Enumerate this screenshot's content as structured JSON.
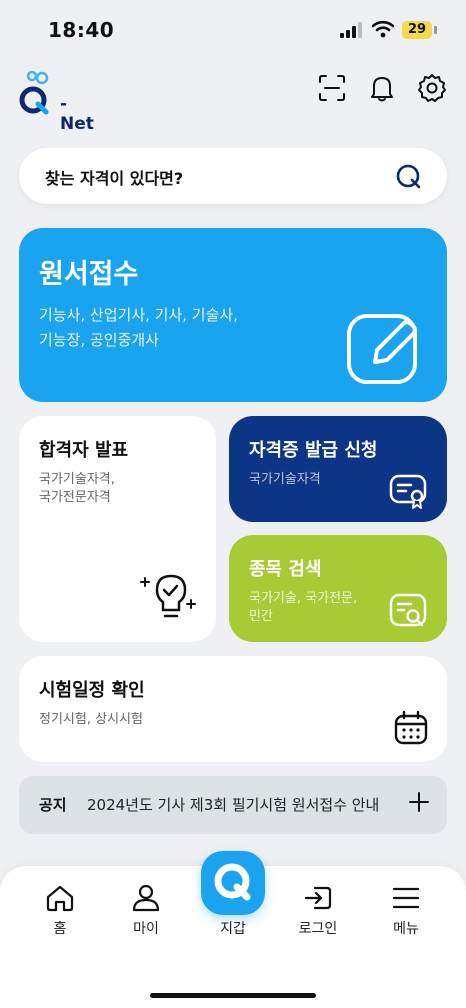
{
  "status_bar": {
    "time": "18:40",
    "battery": "29"
  },
  "header": {
    "logo_text": "-Net"
  },
  "search": {
    "placeholder": "찾는 자격이 있다면?"
  },
  "cards": {
    "apply": {
      "title": "원서접수",
      "lines": [
        "기능사, 산업기사, 기사, 기술사,",
        "기능장, 공인중개사"
      ]
    },
    "pass": {
      "title": "합격자 발표",
      "lines": [
        "국가기술자격,",
        "국가전문자격"
      ]
    },
    "cert": {
      "title": "자격증 발급 신청",
      "lines": [
        "국가기술자격"
      ]
    },
    "item": {
      "title": "종목 검색",
      "lines": [
        "국가기술, 국가전문,",
        "민간"
      ]
    },
    "schedule": {
      "title": "시험일정 확인",
      "lines": [
        "정기시험, 상시시험"
      ]
    }
  },
  "notice": {
    "label": "공지",
    "text": "2024년도 기사 제3회 필기시험 원서접수 안내"
  },
  "nav": {
    "home": "홈",
    "my": "마이",
    "wallet": "지갑",
    "login": "로그인",
    "menu": "메뉴"
  },
  "colors": {
    "primary_blue": "#1aa3ee",
    "navy": "#0d3585",
    "lime": "#a6cb35",
    "background": "#eef0f3"
  }
}
